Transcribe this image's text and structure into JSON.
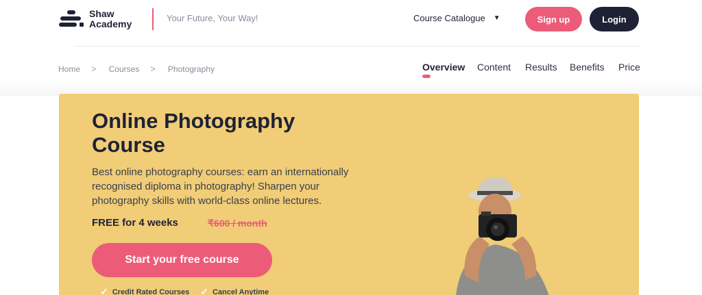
{
  "header": {
    "logo_line1": "Shaw",
    "logo_line2": "Academy",
    "tagline": "Your Future, Your Way!",
    "catalogue_label": "Course Catalogue",
    "signup_label": "Sign up",
    "login_label": "Login"
  },
  "breadcrumb": {
    "items": [
      "Home",
      "Courses",
      "Photography"
    ]
  },
  "tabs": [
    {
      "label": "Overview",
      "active": true
    },
    {
      "label": "Content",
      "active": false
    },
    {
      "label": "Results",
      "active": false
    },
    {
      "label": "Benefits",
      "active": false
    },
    {
      "label": "Price",
      "active": false
    }
  ],
  "hero": {
    "title": "Online Photography Course",
    "description": "Best online photography courses: earn an internationally recognised diploma in photography! Sharpen your photography skills with world-class online lectures.",
    "free_text": "FREE for 4 weeks",
    "old_price": "₹600 / month",
    "cta_label": "Start your free course",
    "features": [
      "Credit Rated Courses",
      "Cancel Anytime"
    ]
  },
  "colors": {
    "accent": "#ec5c79",
    "navy": "#1f2235",
    "hero_bg": "#f0cd76"
  },
  "icons": {
    "caret": "caret-down-icon",
    "check": "check-icon",
    "separator": "chevron-right-icon"
  }
}
